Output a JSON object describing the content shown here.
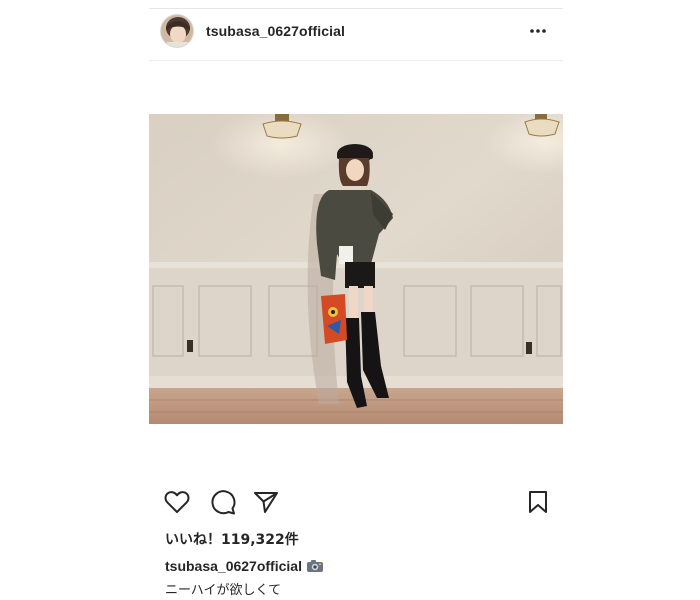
{
  "post": {
    "username": "tsubasa_0627official",
    "likes_text": "いいね！119,322件",
    "caption_username": "tsubasa_0627official",
    "caption_emoji_icon": "camera-icon",
    "caption_text": "ニーハイが欲しくて"
  },
  "icons": {
    "more": "more-dots-icon",
    "like": "heart-icon",
    "comment": "comment-icon",
    "share": "share-icon",
    "save": "bookmark-icon"
  },
  "colors": {
    "text": "#262626",
    "divider": "#efefef"
  }
}
